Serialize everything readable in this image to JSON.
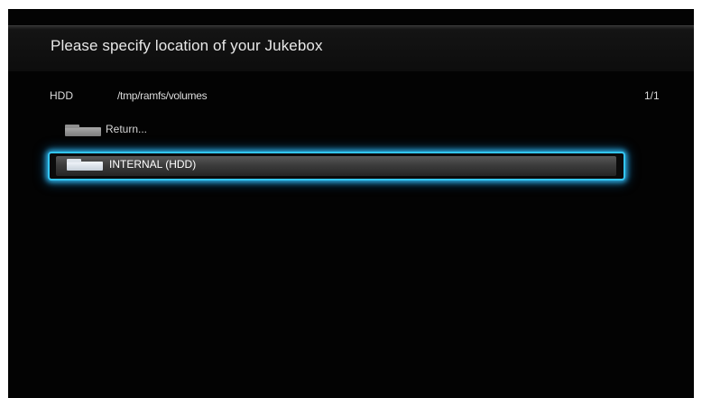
{
  "header": {
    "title": "Please specify location of your Jukebox"
  },
  "location": {
    "device": "HDD",
    "path": "/tmp/ramfs/volumes",
    "page": "1/1"
  },
  "list": {
    "items": [
      {
        "label": "Return...",
        "icon": "folder-icon",
        "selected": false
      },
      {
        "label": "INTERNAL (HDD)",
        "icon": "folder-icon",
        "selected": true
      }
    ]
  },
  "colors": {
    "background": "#030303",
    "highlight": "#33c6f5",
    "text": "#dcdcdc"
  }
}
